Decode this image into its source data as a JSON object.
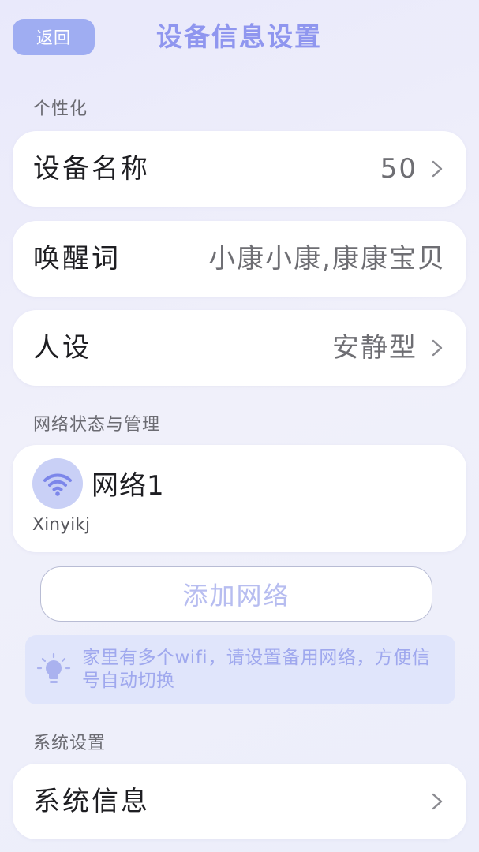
{
  "header": {
    "back_label": "返回",
    "title": "设备信息设置"
  },
  "personalization": {
    "section_label": "个性化",
    "device_name": {
      "label": "设备名称",
      "value": "50"
    },
    "wake_word": {
      "label": "唤醒词",
      "value": "小康小康,康康宝贝"
    },
    "persona": {
      "label": "人设",
      "value": "安静型"
    }
  },
  "network": {
    "section_label": "网络状态与管理",
    "item": {
      "name": "网络1",
      "ssid": "Xinyikj"
    },
    "add_label": "添加网络",
    "tip": "家里有多个wifi，请设置备用网络，方便信号自动切换"
  },
  "system": {
    "section_label": "系统设置",
    "info": {
      "label": "系统信息"
    }
  },
  "colors": {
    "accent": "#9fadf2",
    "title": "#8f96ef",
    "tip_bg": "#e0e5fb",
    "tip_text": "#9fa8ee"
  },
  "icons": [
    "chevron-right-icon",
    "wifi-icon",
    "lightbulb-icon"
  ]
}
